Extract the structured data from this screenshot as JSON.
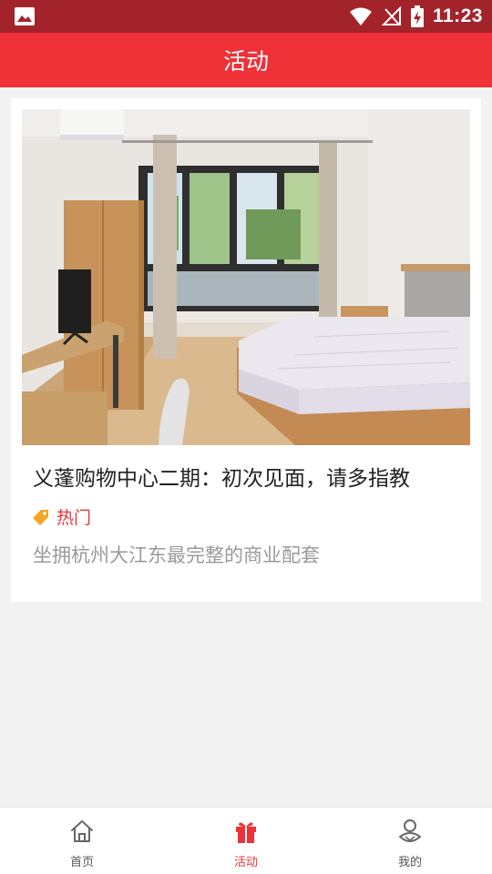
{
  "status_bar": {
    "time": "11:23"
  },
  "header": {
    "title": "活动"
  },
  "activity_card": {
    "title": "义蓬购物中心二期：初次见面，请多指教",
    "tag": "热门",
    "description": "坐拥杭州大江东最完整的商业配套"
  },
  "bottom_nav": {
    "items": [
      {
        "label": "首页",
        "icon": "home-icon",
        "active": false
      },
      {
        "label": "活动",
        "icon": "gift-icon",
        "active": true
      },
      {
        "label": "我的",
        "icon": "profile-icon",
        "active": false
      }
    ]
  },
  "colors": {
    "status_bar": "#a3232a",
    "accent": "#ee3238",
    "tag_icon": "#f5a623"
  }
}
